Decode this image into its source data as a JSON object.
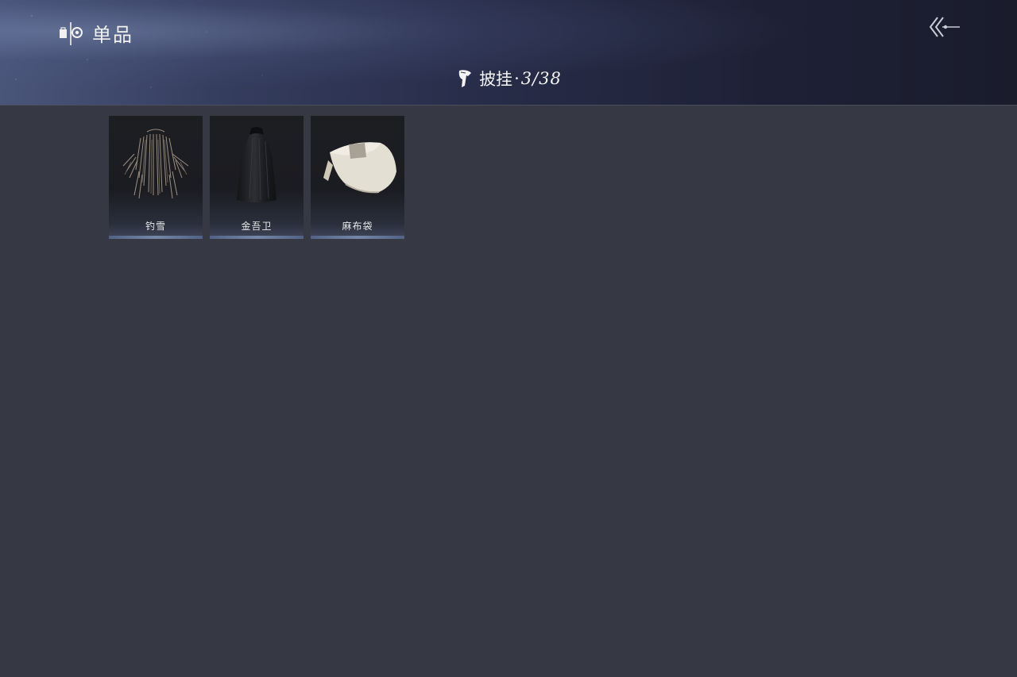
{
  "header": {
    "section_title": "单品",
    "category_name": "披挂",
    "separator": "·",
    "count": "3/38"
  },
  "items": [
    {
      "name": "钓雪",
      "icon": "straw-cape-icon"
    },
    {
      "name": "金吾卫",
      "icon": "black-cloak-icon"
    },
    {
      "name": "麻布袋",
      "icon": "burlap-sack-icon"
    }
  ],
  "colors": {
    "background": "#363943",
    "header_dark": "#1a1c2c",
    "header_light": "#4a557a",
    "card_bg": "#1d1e22",
    "card_accent": "#8ea4c8"
  }
}
